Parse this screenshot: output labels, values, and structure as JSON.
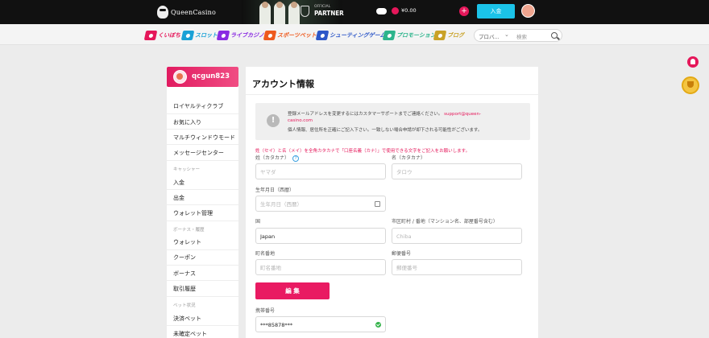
{
  "header": {
    "logo_text": "QueenCasino",
    "partner_small": "OFFICIAL",
    "partner_big": "PARTNER",
    "balance": "¥0.00",
    "plus_label": "+",
    "deposit_label": "入金"
  },
  "nav": {
    "items": [
      {
        "label": "くいぼち",
        "color": "#e5175a"
      },
      {
        "label": "スロット",
        "color": "#1aa1d6"
      },
      {
        "label": "ライブカジノ",
        "color": "#8a2be2"
      },
      {
        "label": "スポーツベット",
        "color": "#ee5a1e"
      },
      {
        "label": "シューティングゲーム",
        "color": "#2d57c8"
      },
      {
        "label": "プロモーション",
        "color": "#2db48c"
      },
      {
        "label": "ブログ",
        "color": "#c9a227"
      }
    ],
    "search_select": "プロバ...",
    "search_placeholder": "検索"
  },
  "sidebar": {
    "username": "qcgun823",
    "items": [
      {
        "label": "ロイヤルティクラブ"
      },
      {
        "label": "お気に入り"
      },
      {
        "label": "マルチウィンドウモード"
      },
      {
        "label": "メッセージセンター"
      },
      {
        "label": "入金"
      },
      {
        "label": "出金"
      },
      {
        "label": "ウォレット管理"
      },
      {
        "label": "ウォレット"
      },
      {
        "label": "クーポン"
      },
      {
        "label": "ボーナス"
      },
      {
        "label": "取引履歴"
      },
      {
        "label": "決済ベット"
      },
      {
        "label": "未確定ベット"
      }
    ],
    "headers": [
      "キャッシャー",
      "ボーナス・履歴",
      "ベット状況"
    ]
  },
  "main": {
    "title": "アカウント情報",
    "notice": {
      "line1": "登録メールアドレスを変更するにはカスタマーサポートまでご連絡ください。",
      "link": "support@queen-",
      "line2": "casino.com",
      "line3": "個人情報、居住所を正確にご記入下さい。一致しない場合申請が却下される可能性がございます。"
    },
    "warning": "姓（セイ）と名（メイ）を全角カタカナで「口座名義（カナ）」で使用できる文字をご記入をお願いします。",
    "fields": {
      "last_name": {
        "label": "姓（カタカナ）",
        "placeholder": "ヤマダ",
        "value": ""
      },
      "first_name": {
        "label": "名（カタカナ）",
        "placeholder": "タロウ",
        "value": ""
      },
      "birthdate": {
        "label": "生年月日（西暦）",
        "placeholder": "生年月日（西暦）",
        "value": ""
      },
      "country": {
        "label": "国",
        "placeholder": "",
        "value": "Japan"
      },
      "city": {
        "label": "市区町村 / 番地（マンション名、部屋番号含む）",
        "placeholder": "Chiba",
        "value": ""
      },
      "town": {
        "label": "町名番地",
        "placeholder": "町名番地",
        "value": ""
      },
      "postal": {
        "label": "郵便番号",
        "placeholder": "郵便番号",
        "value": ""
      },
      "phone": {
        "label": "携帯番号",
        "placeholder": "",
        "value": "***85878***"
      }
    },
    "edit_label": "編 集"
  }
}
